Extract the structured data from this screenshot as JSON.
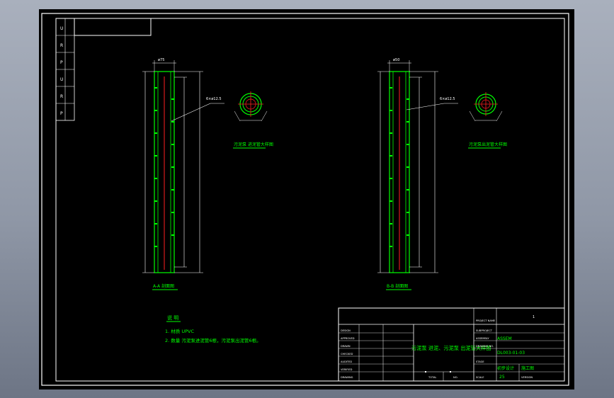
{
  "colors": {
    "frame": "#ffffff",
    "accent": "#00ff00",
    "centerline": "#ff2020",
    "dim": "#ffffff",
    "background": "#000000"
  },
  "side_strip": [
    "U",
    "R",
    "P",
    "U",
    "R",
    "P"
  ],
  "views": {
    "a": {
      "top_dim": "ø75",
      "leader": "6×ø12.5",
      "section_label": "A-A 剖面图",
      "pipe_title": "污泥泵 进泥管大样图"
    },
    "b": {
      "top_dim": "ø50",
      "leader": "6×ø12.5",
      "section_label": "B-B 剖面图",
      "pipe_title": "污泥泵出泥管大样图"
    }
  },
  "notes": {
    "heading": "说 明",
    "line1": "1. 材质 UPVC",
    "line2": "2. 数量  污泥泵进泥管6根，污泥泵出泥管6根。"
  },
  "title_block": {
    "left_labels": [
      "DESIGN",
      "APPROVED",
      "DRAWN",
      "CHECKED",
      "AUDITED",
      "VERIFIED",
      "DRAWING"
    ],
    "center_title": "污泥泵 进泥、污泥泵 出泥管大样图",
    "bottom_labels": [
      "TOTAL",
      "NO."
    ],
    "right_top_mark": "1",
    "right_label_rows": [
      "PROJECT NAME",
      "SUBPROJECT",
      "ASSEMBLY",
      "DRAWING NO.",
      "STAGE",
      "SCALE",
      "VERSION"
    ],
    "assembly": "ASSEM",
    "drawing_no": "DL003-01-03",
    "stage_value": "施工图",
    "scale_value": "25",
    "design_value": "初步设计"
  }
}
